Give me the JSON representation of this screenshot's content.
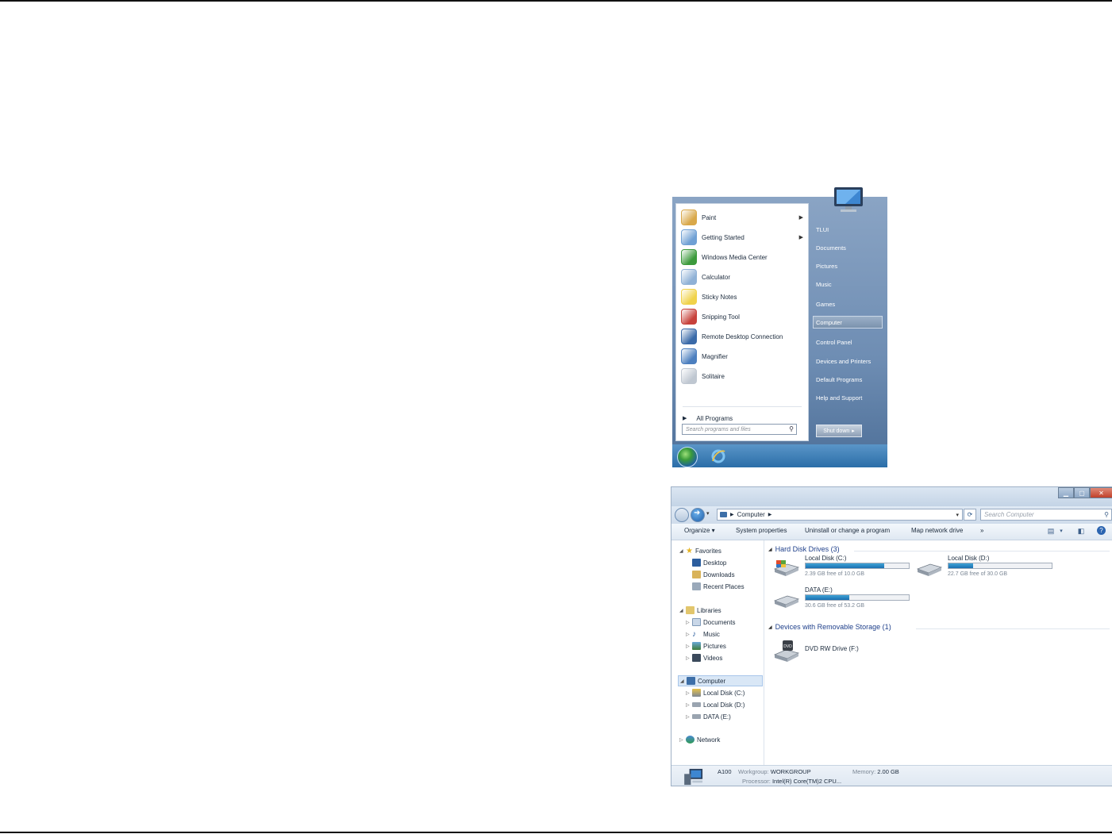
{
  "start_menu": {
    "programs": [
      {
        "label": "Paint",
        "icon": "paint-icon",
        "submenu": true,
        "color": "#d9a84a"
      },
      {
        "label": "Getting Started",
        "icon": "getting-started-icon",
        "submenu": true,
        "color": "#6fa0d4"
      },
      {
        "label": "Windows Media Center",
        "icon": "media-center-icon",
        "submenu": false,
        "color": "#3c9a3c"
      },
      {
        "label": "Calculator",
        "icon": "calculator-icon",
        "submenu": false,
        "color": "#8fb1d6"
      },
      {
        "label": "Sticky Notes",
        "icon": "sticky-notes-icon",
        "submenu": false,
        "color": "#f0d24a"
      },
      {
        "label": "Snipping Tool",
        "icon": "snipping-tool-icon",
        "submenu": false,
        "color": "#c7423c"
      },
      {
        "label": "Remote Desktop Connection",
        "icon": "remote-desktop-icon",
        "submenu": false,
        "color": "#3a6aa8"
      },
      {
        "label": "Magnifier",
        "icon": "magnifier-icon",
        "submenu": false,
        "color": "#4c7fbf"
      },
      {
        "label": "Solitaire",
        "icon": "solitaire-icon",
        "submenu": false,
        "color": "#bfc7d1"
      }
    ],
    "all_programs": "All Programs",
    "search_placeholder": "Search programs and files",
    "right_items": [
      "TLUI",
      "Documents",
      "Pictures",
      "Music",
      "Games",
      "Computer",
      "Control Panel",
      "Devices and Printers",
      "Default Programs",
      "Help and Support"
    ],
    "selected_right": "Computer",
    "shutdown_label": "Shut down"
  },
  "explorer": {
    "address": "Computer",
    "search_placeholder": "Search Computer",
    "toolbar": [
      "Organize ▾",
      "System properties",
      "Uninstall or change a program",
      "Map network drive",
      "»"
    ],
    "nav": {
      "favorites": "Favorites",
      "favorites_items": [
        "Desktop",
        "Downloads",
        "Recent Places"
      ],
      "libraries": "Libraries",
      "libraries_items": [
        "Documents",
        "Music",
        "Pictures",
        "Videos"
      ],
      "computer": "Computer",
      "computer_items": [
        "Local Disk (C:)",
        "Local Disk (D:)",
        "DATA (E:)"
      ],
      "network": "Network"
    },
    "groups": {
      "hdd": "Hard Disk Drives (3)",
      "removable": "Devices with Removable Storage (1)"
    },
    "drives": [
      {
        "name": "Local Disk (C:)",
        "free": "2.39 GB free of 10.0 GB",
        "used_fraction": 0.76
      },
      {
        "name": "Local Disk (D:)",
        "free": "22.7 GB free of 30.0 GB",
        "used_fraction": 0.24
      },
      {
        "name": "DATA (E:)",
        "free": "30.6 GB free of 53.2 GB",
        "used_fraction": 0.42
      }
    ],
    "dvd": "DVD RW Drive (F:)",
    "details": {
      "name": "A100",
      "workgroup_label": "Workgroup:",
      "workgroup": "WORKGROUP",
      "memory_label": "Memory:",
      "memory": "2.00 GB",
      "processor_label": "Processor:",
      "processor": "Intel(R) Core(TM)2 CPU..."
    }
  }
}
